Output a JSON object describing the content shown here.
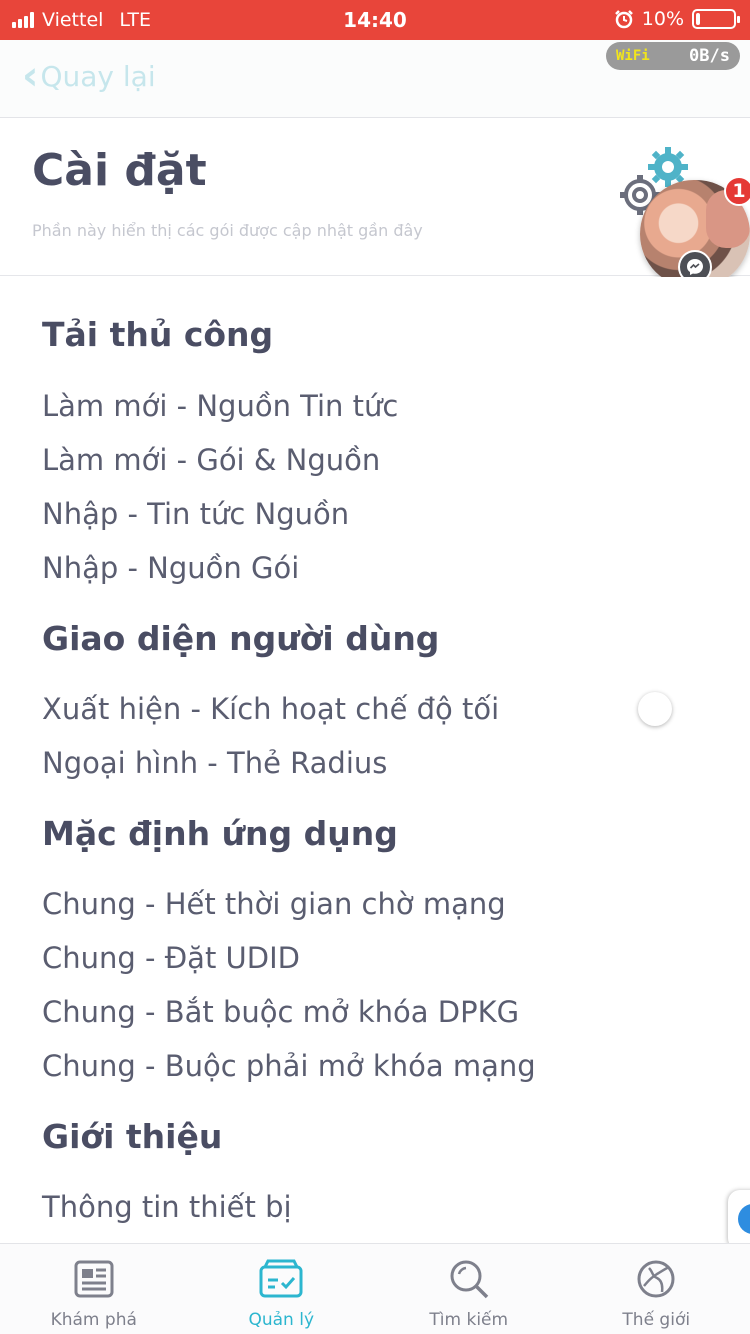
{
  "status_bar": {
    "carrier": "Viettel",
    "network": "LTE",
    "time": "14:40",
    "battery": "10%",
    "battery_level": 0.1,
    "alarm_icon": "alarm-icon"
  },
  "nav": {
    "back_label": "Quay lại",
    "net_badge": {
      "wifi": "WiFi",
      "speed": "0B/s"
    }
  },
  "header": {
    "title": "Cài đặt",
    "subtitle": "Phần này hiển thị các gói được cập nhật gần đây"
  },
  "chat_head": {
    "badge_count": "1"
  },
  "sections": [
    {
      "title": "Tải thủ công",
      "items": [
        "Làm mới - Nguồn Tin tức",
        "Làm mới - Gói & Nguồn",
        "Nhập - Tin tức Nguồn",
        "Nhập - Nguồn Gói"
      ]
    },
    {
      "title": "Giao diện người dùng",
      "items": [
        "Xuất hiện - Kích hoạt chế độ tối",
        "Ngoại hình - Thẻ Radius"
      ],
      "dark_mode_enabled": false
    },
    {
      "title": "Mặc định ứng dụng",
      "items": [
        "Chung - Hết thời gian chờ mạng",
        "Chung - Đặt UDID",
        "Chung - Bắt buộc mở khóa DPKG",
        "Chung - Buộc phải mở khóa mạng"
      ]
    },
    {
      "title": "Giới thiệu",
      "items": [
        "Thông tin thiết bị"
      ]
    }
  ],
  "tabs": [
    {
      "label": "Khám phá",
      "icon": "newspaper-icon",
      "active": false
    },
    {
      "label": "Quản lý",
      "icon": "package-box-icon",
      "active": true
    },
    {
      "label": "Tìm kiếm",
      "icon": "search-icon",
      "active": false
    },
    {
      "label": "Thế giới",
      "icon": "globe-icon",
      "active": false
    }
  ],
  "colors": {
    "status_bar": "#e8453a",
    "accent": "#2cb6cf",
    "text_primary": "#4a4d63",
    "tab_inactive": "#7e808c"
  }
}
